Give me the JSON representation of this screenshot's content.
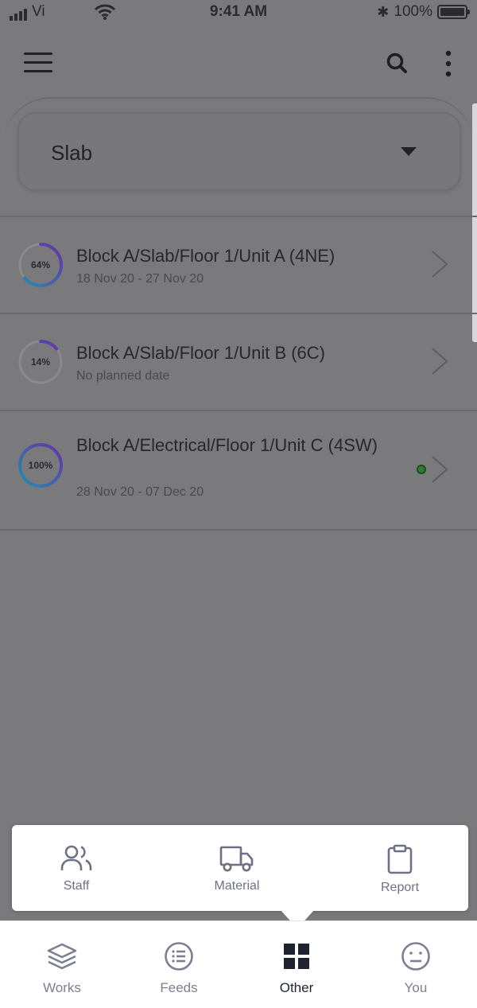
{
  "status_bar": {
    "carrier": "Vi",
    "time": "9:41 AM",
    "battery": "100%"
  },
  "filter": {
    "selected": "Slab"
  },
  "tasks": [
    {
      "percent": "64%",
      "progress": 0.64,
      "title": "Block A/Slab/Floor 1/Unit A (4NE)",
      "subtitle": "18 Nov 20 - 27 Nov 20"
    },
    {
      "percent": "14%",
      "progress": 0.14,
      "title": "Block A/Slab/Floor 1/Unit B (6C)",
      "subtitle": "No planned date"
    },
    {
      "percent": "100%",
      "progress": 1.0,
      "title": "Block A/Electrical/Floor 1/Unit C (4SW)",
      "subtitle": "28 Nov 20 - 07 Dec 20"
    }
  ],
  "popover": {
    "staff": "Staff",
    "material": "Material",
    "report": "Report"
  },
  "bottom_nav": {
    "works": "Works",
    "feeds": "Feeds",
    "other": "Other",
    "you": "You",
    "active": "Other"
  },
  "colors": {
    "ring_start": "#1f8fb0",
    "ring_end": "#6a2fa8",
    "overlay": "#7a797c",
    "active_nav": "#1f2230"
  },
  "icons": [
    "menu-icon",
    "search-icon",
    "more-vertical-icon",
    "chevron-down-icon",
    "chevron-right-icon",
    "staff-icon",
    "truck-icon",
    "clipboard-icon",
    "layers-icon",
    "list-icon",
    "grid-icon",
    "smiley-icon"
  ]
}
